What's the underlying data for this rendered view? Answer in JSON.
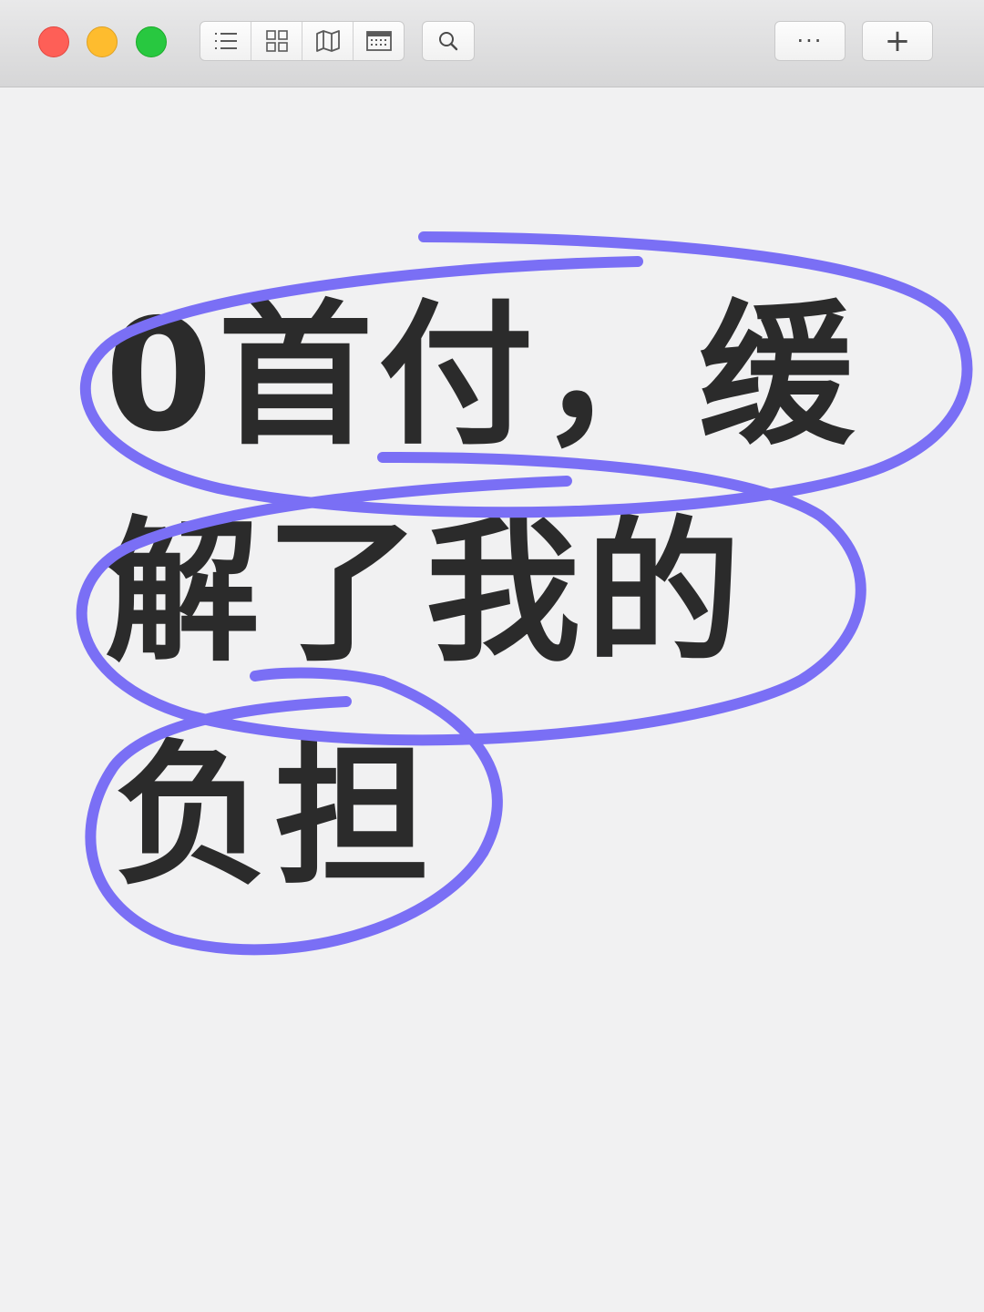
{
  "window": {
    "traffic_lights": [
      "close",
      "minimize",
      "zoom"
    ],
    "view_buttons": [
      {
        "icon": "list-icon"
      },
      {
        "icon": "grid-icon"
      },
      {
        "icon": "map-icon"
      },
      {
        "icon": "calendar-icon"
      }
    ],
    "search_icon": "search-icon",
    "more_label": "···",
    "add_label": "+"
  },
  "note": {
    "lines": [
      "0首付，缓",
      "解了我的",
      "负担"
    ],
    "ink_color": "#2b2b2b",
    "highlight_color": "#7a6ff5"
  }
}
